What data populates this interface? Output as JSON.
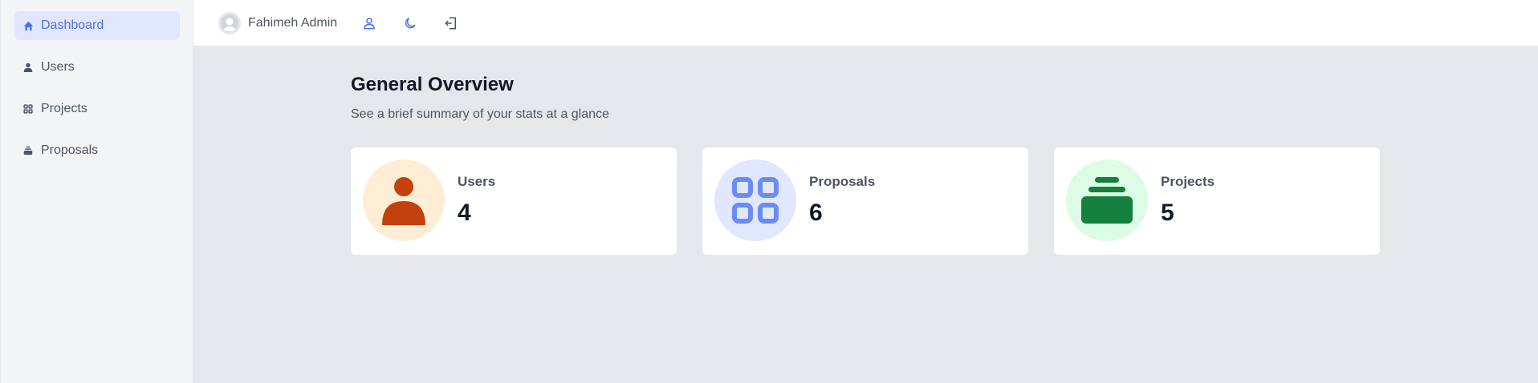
{
  "sidebar": {
    "items": [
      {
        "label": "Dashboard",
        "icon": "home-icon",
        "active": true
      },
      {
        "label": "Users",
        "icon": "user-icon",
        "active": false
      },
      {
        "label": "Projects",
        "icon": "grid-icon",
        "active": false
      },
      {
        "label": "Proposals",
        "icon": "stack-icon",
        "active": false
      }
    ]
  },
  "topbar": {
    "username": "Fahimeh Admin",
    "icons": [
      "profile-icon",
      "moon-icon",
      "logout-icon"
    ]
  },
  "main": {
    "title": "General Overview",
    "subtitle": "See a brief summary of your stats at a glance",
    "cards": [
      {
        "label": "Users",
        "value": "4",
        "icon": "user-icon",
        "icon_bg": "#ffedd5",
        "icon_color": "#c2410c"
      },
      {
        "label": "Proposals",
        "value": "6",
        "icon": "grid-icon",
        "icon_bg": "#e0e7ff",
        "icon_color": "#6b8cf5"
      },
      {
        "label": "Projects",
        "value": "5",
        "icon": "stack-icon",
        "icon_bg": "#dcfce7",
        "icon_color": "#15803d"
      }
    ]
  },
  "colors": {
    "accent": "#4f6fe6",
    "sidebar_bg": "#f3f4f6",
    "content_bg": "#e5e7eb"
  }
}
